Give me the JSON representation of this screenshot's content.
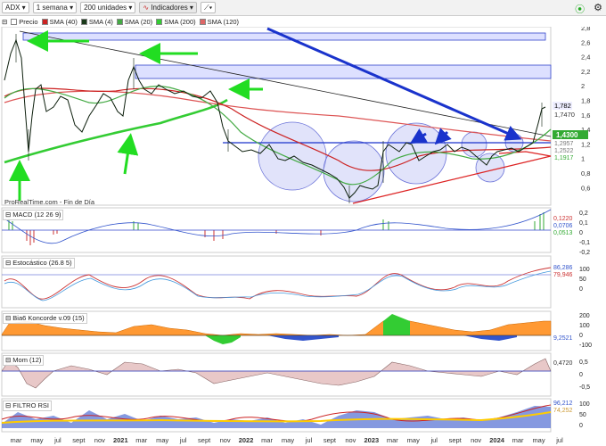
{
  "toolbar": {
    "symbol": "ADX",
    "timeframe": "1 semana",
    "units": "200 unidades",
    "indicators": "Indicadores"
  },
  "legend": {
    "price": "Precio",
    "sma40": "SMA (40)",
    "sma4": "SMA (4)",
    "sma20": "SMA (20)",
    "sma200": "SMA (200)",
    "sma120": "SMA (120)"
  },
  "colors": {
    "sma40": "#cc2222",
    "sma4": "#1a3a1a",
    "sma20": "#44aa44",
    "sma200": "#33cc33",
    "sma120": "#dd6666",
    "arrow_green": "#22dd22",
    "arrow_blue": "#1a33cc"
  },
  "main_axis": [
    "2,8",
    "2,6",
    "2,4",
    "2,2",
    "2",
    "1,8",
    "1,6",
    "1,4",
    "1,2",
    "1",
    "0,8",
    "0,6"
  ],
  "price_labels": [
    "1,782",
    "1,7470",
    "1,4300",
    "1,2957",
    "1,2522",
    "1,1917"
  ],
  "source": "ProRealTime.com - Fin de Día",
  "panels": {
    "macd": {
      "label": "MACD (12 26 9)",
      "axis": [
        "0,2",
        "0,1",
        "0",
        "-0,1",
        "-0,2"
      ],
      "values": [
        "0,1220",
        "0,0706",
        "0,0513"
      ]
    },
    "stoch": {
      "label": "Estocástico (26.8 5)",
      "axis": [
        "100",
        "50",
        "0"
      ],
      "values": [
        "86,286",
        "79,946"
      ]
    },
    "bias": {
      "label": "Bia6 Koncorde v.09 (15)",
      "axis": [
        "200",
        "100",
        "0",
        "-100"
      ],
      "values": [
        "9,2521"
      ]
    },
    "mom": {
      "label": "Mom (12)",
      "axis": [
        "0,5",
        "0",
        "-0,5"
      ],
      "values": [
        "0,4720"
      ]
    },
    "rsi": {
      "label": "FILTRO RSI",
      "axis": [
        "100",
        "50",
        "0"
      ],
      "values": [
        "96,212",
        "74,252"
      ]
    }
  },
  "x_axis": [
    "mar",
    "may",
    "jul",
    "sept",
    "nov",
    "2021",
    "mar",
    "may",
    "jul",
    "sept",
    "nov",
    "2022",
    "mar",
    "may",
    "jul",
    "sept",
    "nov",
    "2023",
    "mar",
    "may",
    "jul",
    "sept",
    "nov",
    "2024",
    "mar",
    "may",
    "jul"
  ]
}
